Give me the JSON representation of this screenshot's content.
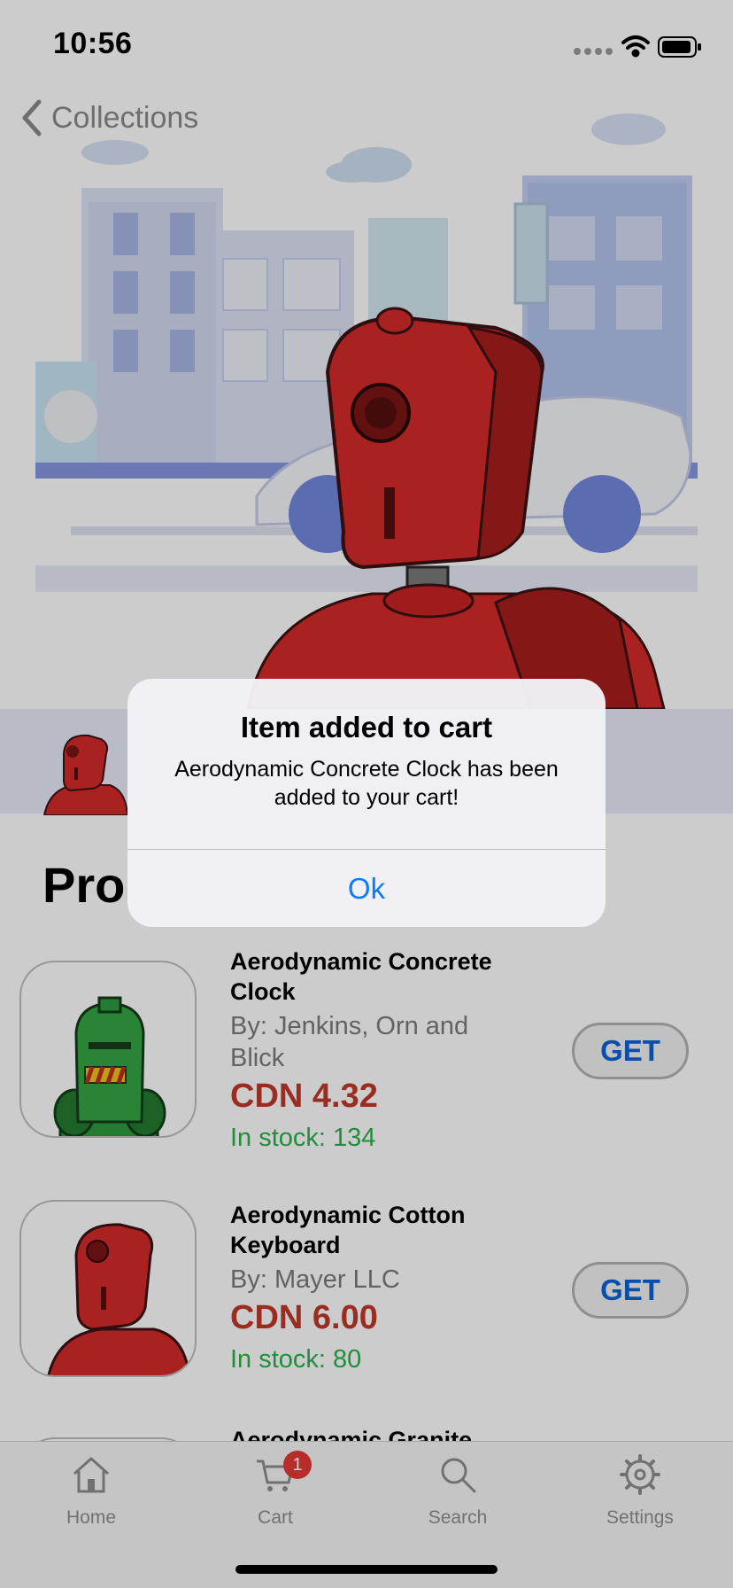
{
  "status_bar": {
    "time": "10:56"
  },
  "nav": {
    "back_label": "Collections",
    "back_icon": "chevron-left-icon"
  },
  "section": {
    "title": "Pro"
  },
  "products": [
    {
      "name": "Aerodynamic Concrete Clock",
      "vendor": "By: Jenkins, Orn and Blick",
      "price": "CDN 4.32",
      "stock": "In stock: 134",
      "get_label": "GET",
      "robot_color": "green"
    },
    {
      "name": "Aerodynamic Cotton Keyboard",
      "vendor": "By: Mayer LLC",
      "price": "CDN 6.00",
      "stock": "In stock: 80",
      "get_label": "GET",
      "robot_color": "red"
    },
    {
      "name": "Aerodynamic Granite",
      "vendor": "",
      "price": "",
      "stock": "",
      "get_label": "",
      "robot_color": ""
    }
  ],
  "tab_bar": {
    "tabs": [
      {
        "label": "Home",
        "icon": "house-icon"
      },
      {
        "label": "Cart",
        "icon": "cart-icon",
        "badge": "1"
      },
      {
        "label": "Search",
        "icon": "search-icon"
      },
      {
        "label": "Settings",
        "icon": "gear-icon"
      }
    ]
  },
  "alert": {
    "title": "Item added to cart",
    "message": "Aerodynamic Concrete Clock has been added to your cart!",
    "button_label": "Ok"
  },
  "colors": {
    "price": "#c0392b",
    "stock": "#2bb24c",
    "accent": "#0a7aff",
    "badge": "#e53935"
  }
}
